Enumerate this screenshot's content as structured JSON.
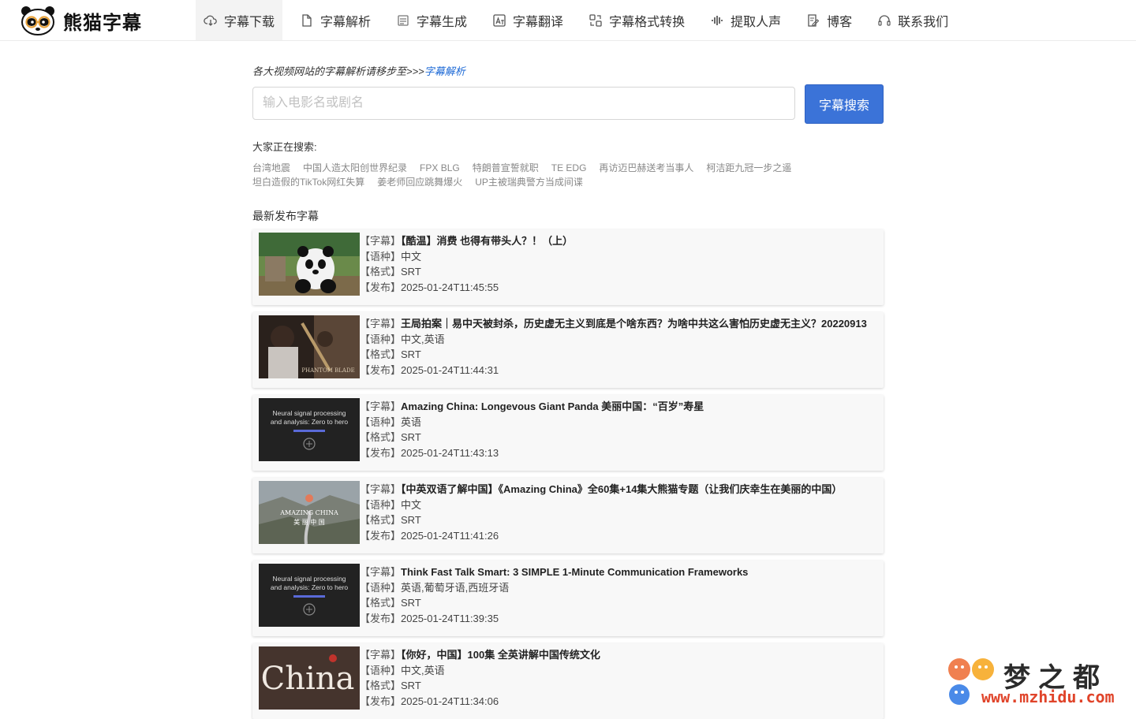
{
  "brand": {
    "name": "熊猫字幕"
  },
  "nav": {
    "items": [
      {
        "label": "字幕下载",
        "icon": "cloud-download-icon",
        "active": true
      },
      {
        "label": "字幕解析",
        "icon": "file-icon"
      },
      {
        "label": "字幕生成",
        "icon": "layers-icon"
      },
      {
        "label": "字幕翻译",
        "icon": "translate-icon"
      },
      {
        "label": "字幕格式转换",
        "icon": "convert-icon"
      },
      {
        "label": "提取人声",
        "icon": "waveform-icon"
      },
      {
        "label": "博客",
        "icon": "edit-icon"
      },
      {
        "label": "联系我们",
        "icon": "headset-icon"
      }
    ]
  },
  "hint": {
    "text": "各大视频网站的字幕解析请移步至>>>",
    "link": "字幕解析"
  },
  "search": {
    "placeholder": "输入电影名或剧名",
    "value": "",
    "button": "字幕搜索"
  },
  "trending": {
    "label": "大家正在搜索:",
    "row1": [
      "台湾地震",
      "中国人造太阳创世界纪录",
      "FPX BLG",
      "特朗普宣誓就职",
      "TE EDG",
      "再访迈巴赫送考当事人",
      "柯洁距九冠一步之遥"
    ],
    "row2": [
      "坦白造假的TikTok网红失算",
      "姜老师回应跳舞爆火",
      "UP主被瑞典警方当成间谍"
    ]
  },
  "latest": {
    "title": "最新发布字幕",
    "keys": {
      "subtitle": "【字幕】",
      "language": "【语种】",
      "format": "【格式】",
      "published": "【发布】"
    },
    "items": [
      {
        "title": "【酷温】消费 也得有带头人？！（上）",
        "language": "中文",
        "format": "SRT",
        "published": "2025-01-24T11:45:55",
        "thumb": "panda"
      },
      {
        "title": "王局拍案｜易中天被封杀，历史虚无主义到底是个啥东西？为啥中共这么害怕历史虚无主义？20220913",
        "language": "中文,英语",
        "format": "SRT",
        "published": "2025-01-24T11:44:31",
        "thumb": "warrior",
        "thumb_text": "PHANTOM BLADE"
      },
      {
        "title": "Amazing China: Longevous Giant Panda 美丽中国：“百岁”寿星",
        "language": "英语",
        "format": "SRT",
        "published": "2025-01-24T11:43:13",
        "thumb": "neural",
        "thumb_text": [
          "Neural signal processing",
          "and analysis: Zero to hero"
        ]
      },
      {
        "title": "【中英双语了解中国】《Amazing China》全60集+14集大熊猫专题（让我们庆幸生在美丽的中国）",
        "language": "中文",
        "format": "SRT",
        "published": "2025-01-24T11:41:26",
        "thumb": "landscape",
        "thumb_text": [
          "AMAZING CHINA",
          "美 丽 中 国"
        ]
      },
      {
        "title": "Think Fast Talk Smart: 3 SIMPLE 1-Minute Communication Frameworks",
        "language": "英语,葡萄牙语,西班牙语",
        "format": "SRT",
        "published": "2025-01-24T11:39:35",
        "thumb": "neural",
        "thumb_text": [
          "Neural signal processing",
          "and analysis: Zero to hero"
        ]
      },
      {
        "title": "【你好，中国】100集 全英讲解中国传统文化",
        "language": "中文,英语",
        "format": "SRT",
        "published": "2025-01-24T11:34:06",
        "thumb": "china",
        "thumb_text": "China"
      }
    ]
  },
  "watermark": {
    "title": "梦之都",
    "url": "www.mzhidu.com"
  }
}
